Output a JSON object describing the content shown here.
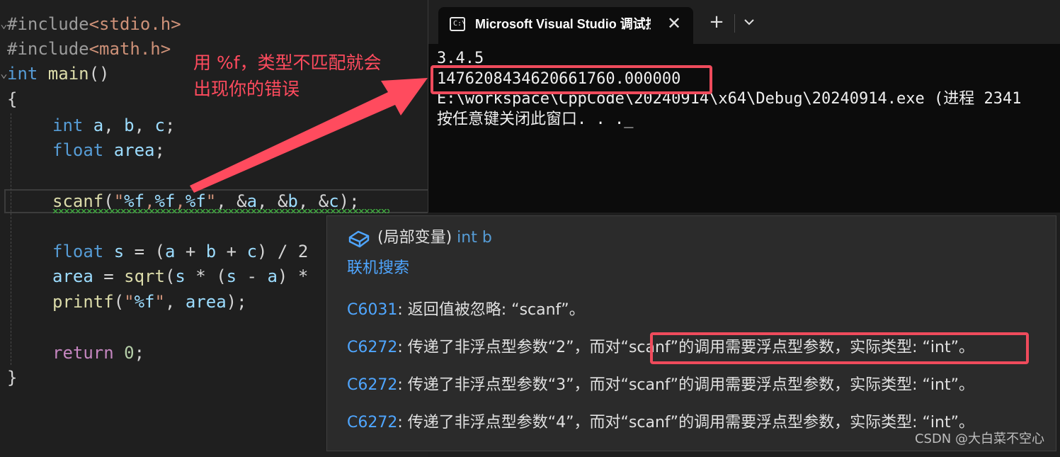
{
  "editor": {
    "code": {
      "l1_a": "#include",
      "l1_b": "<stdio.h>",
      "l2_a": "#include",
      "l2_b": "<math.h>",
      "l3_a": "int",
      "l3_b": " main",
      "l3_c": "()",
      "l4": "{",
      "l5_a": "int",
      "l5_b": " a",
      "l5_c": ", ",
      "l5_d": "b",
      "l5_e": ", ",
      "l5_f": "c",
      "l5_g": ";",
      "l6_a": "float",
      "l6_b": " area",
      "l6_c": ";",
      "l7_a": "scanf",
      "l7_b": "(",
      "l7_c": "\"",
      "l7_d": "%f",
      "l7_e": ",",
      "l7_f": "%f",
      "l7_g": ",",
      "l7_h": "%f",
      "l7_i": "\"",
      "l7_j": ", &",
      "l7_k": "a",
      "l7_l": ", &",
      "l7_m": "b",
      "l7_n": ", &",
      "l7_o": "c",
      "l7_p": ");",
      "l8_a": "float",
      "l8_b": " s",
      "l8_c": " = (",
      "l8_d": "a",
      "l8_e": " + ",
      "l8_f": "b",
      "l8_g": " + ",
      "l8_h": "c",
      "l8_i": ") / 2",
      "l9_a": "area",
      "l9_b": " = ",
      "l9_c": "sqrt",
      "l9_d": "(",
      "l9_e": "s",
      "l9_f": " * (",
      "l9_g": "s",
      "l9_h": " - ",
      "l9_i": "a",
      "l9_j": ") *",
      "l10_a": "printf",
      "l10_b": "(",
      "l10_c": "\"",
      "l10_d": "%f",
      "l10_e": "\"",
      "l10_f": ", ",
      "l10_g": "area",
      "l10_h": ");",
      "l11_a": "return",
      "l11_b": " 0",
      "l11_c": ";",
      "l12": "}"
    }
  },
  "console": {
    "tab_title": "Microsoft Visual Studio 调试控制台",
    "icon_text": "C:\\",
    "close_glyph": "✕",
    "new_tab_glyph": "+",
    "lines": [
      "3.4.5",
      "1476208434620661760.000000",
      "E:\\workspace\\CppCode\\20240914\\x64\\Debug\\20240914.exe (进程 2341",
      "按任意键关闭此窗口. . ._"
    ]
  },
  "annotation": {
    "line1": "用 %f，类型不匹配就会",
    "line2": "出现你的错误"
  },
  "tooltip": {
    "header_prefix": "(局部变量) ",
    "header_type": "int b",
    "search_link": "联机搜索",
    "messages": [
      {
        "code": "C6031",
        "text": ": 返回值被忽略: “scanf”。"
      },
      {
        "code": "C6272",
        "text": ": 传递了非浮点型参数“2”，而对“scanf”的调用需要浮点型参数，实际类型: “int”。"
      },
      {
        "code": "C6272",
        "text": ": 传递了非浮点型参数“3”，而对“scanf”的调用需要浮点型参数，实际类型: “int”。"
      },
      {
        "code": "C6272",
        "text": ": 传递了非浮点型参数“4”，而对“scanf”的调用需要浮点型参数，实际类型: “int”。"
      }
    ]
  },
  "watermark": "CSDN @大白菜不空心",
  "colors": {
    "highlight": "#ef4b5c",
    "keyword": "#569cd6",
    "link": "#4fa6ff",
    "squiggle": "#3ea63e"
  }
}
